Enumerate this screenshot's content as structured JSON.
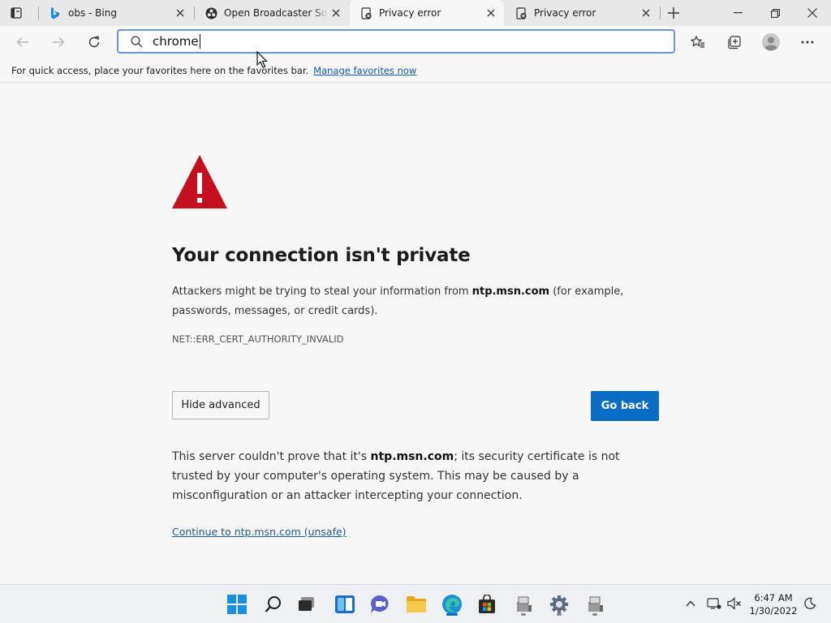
{
  "browser": {
    "tabs": [
      {
        "title": "obs - Bing",
        "favicon": "bing-icon",
        "active": false
      },
      {
        "title": "Open Broadcaster Software",
        "favicon": "obs-icon",
        "active": false
      },
      {
        "title": "Privacy error",
        "favicon": "privacy-error-icon",
        "active": true
      },
      {
        "title": "Privacy error",
        "favicon": "privacy-error-icon",
        "active": false
      }
    ],
    "address_bar": {
      "value": "chrome"
    },
    "favorites_bar": {
      "message": "For quick access, place your favorites here on the favorites bar.",
      "link": "Manage favorites now"
    }
  },
  "page": {
    "heading": "Your connection isn't private",
    "para1": {
      "before": "Attackers might be trying to steal your information from ",
      "host": "ntp.msn.com",
      "after": " (for example, passwords, messages, or credit cards)."
    },
    "error_code": "NET::ERR_CERT_AUTHORITY_INVALID",
    "hide_advanced_label": "Hide advanced",
    "go_back_label": "Go back",
    "para2": {
      "before": "This server couldn't prove that it's ",
      "host": "ntp.msn.com",
      "after": "; its security certificate is not trusted by your computer's operating system. This may be caused by a misconfiguration or an attacker intercepting your connection."
    },
    "unsafe_link": "Continue to ntp.msn.com (unsafe)"
  },
  "taskbar": {
    "clock_time": "6:47 AM",
    "clock_date": "1/30/2022"
  },
  "colors": {
    "warning_red": "#c50f1f",
    "accent_blue": "#0b6cc4",
    "link_blue": "#0f5aa8"
  }
}
